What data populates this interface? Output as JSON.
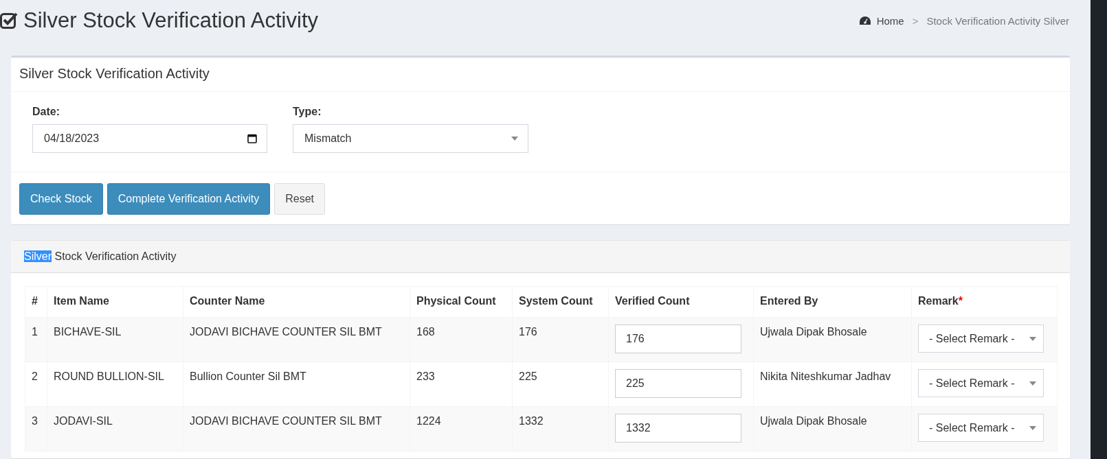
{
  "page": {
    "title": "Silver Stock Verification Activity"
  },
  "breadcrumb": [
    {
      "label": "Home",
      "kind": "link"
    },
    {
      "label": "Stock Verification Activity Silver",
      "kind": "current"
    }
  ],
  "breadcrumb_separator": ">",
  "filter_box": {
    "title": "Silver Stock Verification Activity",
    "date": {
      "label": "Date:",
      "value": "04/18/2023"
    },
    "type": {
      "label": "Type:",
      "value": "Mismatch"
    },
    "buttons": [
      {
        "label": "Check Stock",
        "kind": "primary"
      },
      {
        "label": "Complete Verification Activity",
        "kind": "primary"
      },
      {
        "label": "Reset",
        "kind": "default"
      }
    ]
  },
  "results_box": {
    "title_parts": [
      {
        "text": "Silver",
        "selected": true
      },
      {
        "text": " Stock Verification Activity",
        "selected": false
      }
    ],
    "table": {
      "columns": [
        {
          "label": "#"
        },
        {
          "label": "Item Name"
        },
        {
          "label": "Counter Name"
        },
        {
          "label": "Physical Count"
        },
        {
          "label": "System Count"
        },
        {
          "label": "Verified Count"
        },
        {
          "label": "Entered By"
        },
        {
          "label": "Remark",
          "required_mark": "*"
        }
      ],
      "rows": [
        {
          "number": "1",
          "item_name": "BICHAVE-SIL",
          "counter_name": "JODAVI BICHAVE COUNTER SIL BMT",
          "physical_count": "168",
          "system_count": "176",
          "verified_count": "176",
          "entered_by": "Ujwala Dipak Bhosale",
          "remark": "- Select Remark -"
        },
        {
          "number": "2",
          "item_name": "ROUND BULLION-SIL",
          "counter_name": "Bullion Counter Sil BMT",
          "physical_count": "233",
          "system_count": "225",
          "verified_count": "225",
          "entered_by": "Nikita Niteshkumar Jadhav",
          "remark": "- Select Remark -"
        },
        {
          "number": "3",
          "item_name": "JODAVI-SIL",
          "counter_name": "JODAVI BICHAVE COUNTER SIL BMT",
          "physical_count": "1224",
          "system_count": "1332",
          "verified_count": "1332",
          "entered_by": "Ujwala Dipak Bhosale",
          "remark": "- Select Remark -"
        }
      ]
    }
  }
}
